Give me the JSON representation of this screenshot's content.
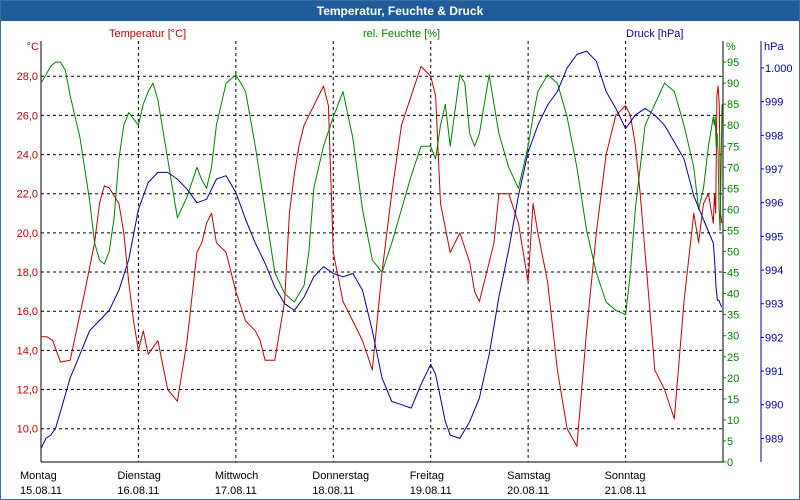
{
  "window": {
    "title": "Temperatur, Feuchte & Druck"
  },
  "colors": {
    "temperature": "#c00000",
    "humidity": "#008000",
    "pressure": "#000099",
    "grid": "#000000",
    "titlebar": "#1f5c99"
  },
  "chart_data": {
    "type": "line",
    "title": "Temperatur, Feuchte & Druck",
    "grid": true,
    "categories": [
      {
        "day": "Montag",
        "date": "15.08.11"
      },
      {
        "day": "Dienstag",
        "date": "16.08.11"
      },
      {
        "day": "Mittwoch",
        "date": "17.08.11"
      },
      {
        "day": "Donnerstag",
        "date": "18.08.11"
      },
      {
        "day": "Freitag",
        "date": "19.08.11"
      },
      {
        "day": "Samstag",
        "date": "20.08.11"
      },
      {
        "day": "Sonntag",
        "date": "21.08.11"
      }
    ],
    "xlim": [
      0,
      7
    ],
    "axes": {
      "temperature": {
        "label": "Temperatur [°C]",
        "unit": "°C",
        "side": "left",
        "ylim": [
          8.3,
          29.8
        ],
        "ticks": [
          "10,0",
          "12,0",
          "14,0",
          "16,0",
          "18,0",
          "20,0",
          "22,0",
          "24,0",
          "26,0",
          "28,0"
        ],
        "tick_values": [
          10,
          12,
          14,
          16,
          18,
          20,
          22,
          24,
          26,
          28
        ]
      },
      "humidity": {
        "label": "rel. Feuchte [%]",
        "unit": "%",
        "side": "right",
        "ylim": [
          0,
          100
        ],
        "ticks": [
          "0",
          "5",
          "10",
          "15",
          "20",
          "25",
          "30",
          "35",
          "40",
          "45",
          "50",
          "55",
          "60",
          "65",
          "70",
          "75",
          "80",
          "85",
          "90",
          "95"
        ],
        "tick_values": [
          0,
          5,
          10,
          15,
          20,
          25,
          30,
          35,
          40,
          45,
          50,
          55,
          60,
          65,
          70,
          75,
          80,
          85,
          90,
          95
        ]
      },
      "pressure": {
        "label": "Druck [hPa]",
        "unit": "hPa",
        "side": "right",
        "ylim": [
          988.3,
          1000.8
        ],
        "ticks": [
          "989",
          "990",
          "991",
          "992",
          "993",
          "994",
          "995",
          "996",
          "997",
          "998",
          "999",
          "1.000"
        ],
        "tick_values": [
          989,
          990,
          991,
          992,
          993,
          994,
          995,
          996,
          997,
          998,
          999,
          1000
        ]
      }
    },
    "series": [
      {
        "name": "Temperatur [°C]",
        "axis": "temperature",
        "x": [
          0,
          0.06,
          0.12,
          0.2,
          0.3,
          0.45,
          0.55,
          0.6,
          0.65,
          0.7,
          0.8,
          0.85,
          0.9,
          0.95,
          1.0,
          1.05,
          1.1,
          1.2,
          1.3,
          1.4,
          1.5,
          1.6,
          1.65,
          1.7,
          1.75,
          1.8,
          1.9,
          2.0,
          2.1,
          2.2,
          2.25,
          2.3,
          2.4,
          2.5,
          2.55,
          2.6,
          2.65,
          2.7,
          2.8,
          2.9,
          2.95,
          3.0,
          3.1,
          3.2,
          3.3,
          3.4,
          3.5,
          3.6,
          3.7,
          3.8,
          3.9,
          4.0,
          4.05,
          4.1,
          4.2,
          4.3,
          4.4,
          4.45,
          4.5,
          4.55,
          4.6,
          4.65,
          4.7,
          4.8,
          4.9,
          5.0,
          5.05,
          5.1,
          5.2,
          5.3,
          5.4,
          5.5,
          5.6,
          5.7,
          5.8,
          5.9,
          6.0,
          6.05,
          6.1,
          6.15,
          6.2,
          6.3,
          6.4,
          6.5,
          6.6,
          6.7,
          6.75,
          6.8,
          6.85,
          6.9
        ],
        "y": [
          14.7,
          14.7,
          14.5,
          13.4,
          13.5,
          17.0,
          19.5,
          21.5,
          22.4,
          22.3,
          21.5,
          20.0,
          17.5,
          15.5,
          14.0,
          15.0,
          13.8,
          14.5,
          12.0,
          11.4,
          14.5,
          19.0,
          19.5,
          20.5,
          21.0,
          19.5,
          19.0,
          17.0,
          15.5,
          15.0,
          14.5,
          13.5,
          13.5,
          16.5,
          21.0,
          23.0,
          24.5,
          25.5,
          26.5,
          27.5,
          26.5,
          19.0,
          16.5,
          15.5,
          14.5,
          13.0,
          18.0,
          22.0,
          25.5,
          27.0,
          28.5,
          28.0,
          27.0,
          21.5,
          19.0,
          20.0,
          18.5,
          17.0,
          16.5,
          17.5,
          18.5,
          19.5,
          22.0,
          22.0,
          20.5,
          17.5,
          21.5,
          20.0,
          17.5,
          13.0,
          10.0,
          9.1,
          15.0,
          20.0,
          24.0,
          26.0,
          26.5,
          26.0,
          24.5,
          22.0,
          19.0,
          13.0,
          12.0,
          10.5,
          16.5,
          21.0,
          19.5,
          21.5,
          22.0,
          20.5
        ],
        "y2": [
          22.0,
          21.0,
          27.0,
          27.5,
          26.5,
          21.0,
          20.5
        ]
      },
      {
        "name": "rel. Feuchte [%]",
        "axis": "humidity",
        "x": [
          0,
          0.05,
          0.1,
          0.15,
          0.2,
          0.25,
          0.3,
          0.4,
          0.5,
          0.55,
          0.6,
          0.65,
          0.7,
          0.75,
          0.8,
          0.85,
          0.9,
          1.0,
          1.05,
          1.1,
          1.15,
          1.2,
          1.3,
          1.35,
          1.4,
          1.5,
          1.6,
          1.65,
          1.7,
          1.75,
          1.8,
          1.9,
          2.0,
          2.1,
          2.2,
          2.3,
          2.4,
          2.5,
          2.6,
          2.7,
          2.75,
          2.8,
          2.9,
          3.0,
          3.05,
          3.1,
          3.2,
          3.3,
          3.4,
          3.5,
          3.6,
          3.7,
          3.8,
          3.9,
          4.0,
          4.05,
          4.1,
          4.15,
          4.2,
          4.3,
          4.35,
          4.4,
          4.45,
          4.5,
          4.6,
          4.65,
          4.7,
          4.8,
          4.9,
          5.0,
          5.05,
          5.1,
          5.2,
          5.3,
          5.4,
          5.5,
          5.6,
          5.7,
          5.8,
          5.9,
          6.0,
          6.05,
          6.1,
          6.2,
          6.3,
          6.4,
          6.5,
          6.6,
          6.7,
          6.75,
          6.8,
          6.85,
          6.9
        ],
        "y": [
          90,
          92,
          94,
          95,
          95,
          93,
          87,
          77,
          62,
          52,
          48,
          47,
          50,
          58,
          72,
          80,
          83,
          80,
          85,
          88,
          90,
          86,
          72,
          65,
          58,
          63,
          70,
          67,
          65,
          70,
          80,
          90,
          92,
          88,
          75,
          60,
          45,
          40,
          38,
          42,
          50,
          65,
          75,
          82,
          85,
          88,
          77,
          60,
          48,
          45,
          52,
          60,
          68,
          75,
          75,
          72,
          80,
          85,
          75,
          92,
          90,
          78,
          75,
          78,
          92,
          85,
          78,
          70,
          65,
          75,
          82,
          88,
          92,
          90,
          82,
          70,
          55,
          45,
          38,
          36,
          35,
          45,
          60,
          80,
          85,
          90,
          88,
          80,
          70,
          60,
          65,
          75,
          82
        ],
        "y2": [
          80,
          82,
          75,
          78,
          73,
          60,
          55,
          70,
          85
        ]
      },
      {
        "name": "Druck [hPa]",
        "axis": "pressure",
        "x": [
          0,
          0.05,
          0.1,
          0.15,
          0.2,
          0.3,
          0.4,
          0.5,
          0.6,
          0.7,
          0.8,
          0.9,
          1.0,
          1.1,
          1.2,
          1.3,
          1.4,
          1.5,
          1.6,
          1.7,
          1.8,
          1.9,
          2.0,
          2.1,
          2.2,
          2.3,
          2.4,
          2.5,
          2.6,
          2.7,
          2.8,
          2.9,
          3.0,
          3.1,
          3.2,
          3.3,
          3.4,
          3.5,
          3.6,
          3.7,
          3.8,
          3.9,
          4.0,
          4.05,
          4.1,
          4.15,
          4.2,
          4.3,
          4.4,
          4.5,
          4.6,
          4.7,
          4.8,
          4.9,
          5.0,
          5.1,
          5.2,
          5.3,
          5.4,
          5.5,
          5.6,
          5.7,
          5.8,
          5.9,
          6.0,
          6.1,
          6.2,
          6.3,
          6.4,
          6.5,
          6.6,
          6.7,
          6.8,
          6.9
        ],
        "y": [
          988.7,
          989.0,
          989.1,
          989.3,
          989.8,
          990.8,
          991.5,
          992.2,
          992.5,
          992.8,
          993.4,
          994.3,
          995.8,
          996.6,
          996.9,
          996.9,
          996.7,
          996.4,
          996.0,
          996.1,
          996.7,
          996.8,
          996.3,
          995.5,
          994.8,
          994.2,
          993.5,
          993.0,
          992.8,
          993.2,
          993.8,
          994.1,
          993.9,
          993.8,
          993.9,
          993.4,
          992.2,
          990.8,
          990.1,
          990.0,
          989.9,
          990.6,
          991.2,
          990.9,
          990.2,
          989.5,
          989.1,
          989.0,
          989.5,
          990.2,
          991.5,
          993.2,
          994.6,
          996.2,
          997.5,
          998.3,
          998.9,
          999.3,
          1000.0,
          1000.4,
          1000.5,
          1000.2,
          999.3,
          998.8,
          998.2,
          998.6,
          998.8,
          998.6,
          998.3,
          997.8,
          997.3,
          996.2,
          995.5,
          994.8
        ],
        "y2": [
          994.3,
          993.5,
          993.1,
          993.1,
          993.0,
          992.9
        ]
      }
    ]
  }
}
